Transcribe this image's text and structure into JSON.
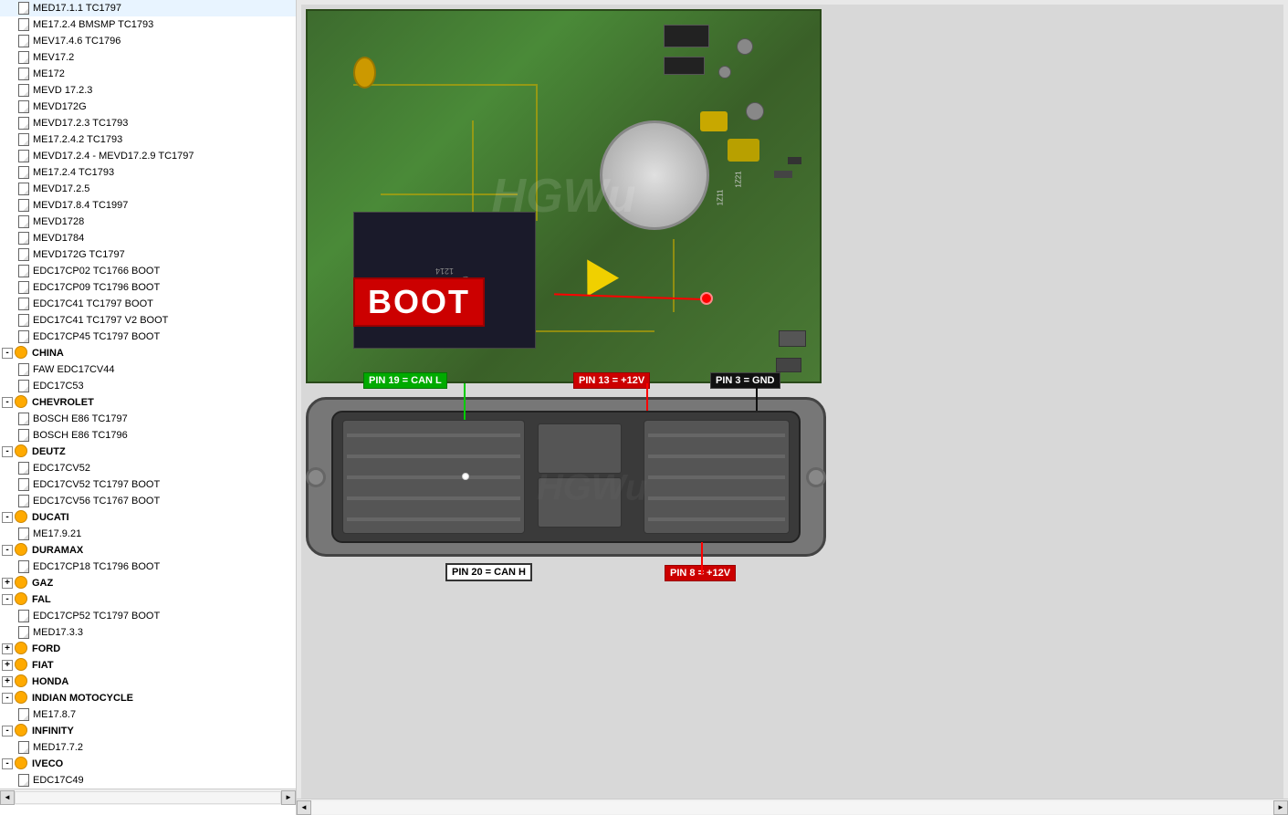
{
  "leftPanel": {
    "treeItems": [
      {
        "id": "med1711",
        "label": "MED17.1.1  TC1797",
        "level": 2,
        "type": "doc"
      },
      {
        "id": "me1724",
        "label": "ME17.2.4  BMSMP TC1793",
        "level": 2,
        "type": "doc"
      },
      {
        "id": "mev1746",
        "label": "MEV17.4.6 TC1796",
        "level": 2,
        "type": "doc"
      },
      {
        "id": "mev172",
        "label": "MEV17.2",
        "level": 2,
        "type": "doc"
      },
      {
        "id": "me172",
        "label": "ME172",
        "level": 2,
        "type": "doc"
      },
      {
        "id": "mevd1723",
        "label": "MEVD 17.2.3",
        "level": 2,
        "type": "doc"
      },
      {
        "id": "mevd172g",
        "label": "MEVD172G",
        "level": 2,
        "type": "doc"
      },
      {
        "id": "mevd1723tc",
        "label": "MEVD17.2.3 TC1793",
        "level": 2,
        "type": "doc"
      },
      {
        "id": "me17242",
        "label": "ME17.2.4.2 TC1793",
        "level": 2,
        "type": "doc"
      },
      {
        "id": "mevd1724",
        "label": "MEVD17.2.4 - MEVD17.2.9 TC1797",
        "level": 2,
        "type": "doc"
      },
      {
        "id": "me17244",
        "label": "ME17.2.4 TC1793",
        "level": 2,
        "type": "doc"
      },
      {
        "id": "mevd1725",
        "label": "MEVD17.2.5",
        "level": 2,
        "type": "doc"
      },
      {
        "id": "mevd1784",
        "label": "MEVD17.8.4 TC1997",
        "level": 2,
        "type": "doc"
      },
      {
        "id": "mevd1728",
        "label": "MEVD1728",
        "level": 2,
        "type": "doc"
      },
      {
        "id": "mevd17284",
        "label": "MEVD1784",
        "level": 2,
        "type": "doc"
      },
      {
        "id": "mevd172gtc",
        "label": "MEVD172G TC1797",
        "level": 2,
        "type": "doc"
      },
      {
        "id": "edc17cp02",
        "label": "EDC17CP02 TC1766 BOOT",
        "level": 2,
        "type": "doc"
      },
      {
        "id": "edc17cp09",
        "label": "EDC17CP09 TC1796 BOOT",
        "level": 2,
        "type": "doc"
      },
      {
        "id": "edc17c41",
        "label": "EDC17C41 TC1797 BOOT",
        "level": 2,
        "type": "doc"
      },
      {
        "id": "edc17c41v2",
        "label": "EDC17C41 TC1797 V2 BOOT",
        "level": 2,
        "type": "doc"
      },
      {
        "id": "edc17cp45",
        "label": "EDC17CP45 TC1797 BOOT",
        "level": 2,
        "type": "doc"
      },
      {
        "id": "china",
        "label": "CHINA",
        "level": 1,
        "type": "folder",
        "expanded": true
      },
      {
        "id": "faw",
        "label": "FAW EDC17CV44",
        "level": 2,
        "type": "doc"
      },
      {
        "id": "edc17c53",
        "label": "EDC17C53",
        "level": 2,
        "type": "doc"
      },
      {
        "id": "chevrolet",
        "label": "CHEVROLET",
        "level": 1,
        "type": "folder",
        "expanded": true
      },
      {
        "id": "bossche86tc1797",
        "label": "BOSCH E86 TC1797",
        "level": 2,
        "type": "doc"
      },
      {
        "id": "bossche86tc1796",
        "label": "BOSCH E86 TC1796",
        "level": 2,
        "type": "doc"
      },
      {
        "id": "deutz",
        "label": "DEUTZ",
        "level": 1,
        "type": "folder",
        "expanded": true
      },
      {
        "id": "edc17cv52",
        "label": "EDC17CV52",
        "level": 2,
        "type": "doc"
      },
      {
        "id": "edc17cv52boot",
        "label": "EDC17CV52 TC1797 BOOT",
        "level": 2,
        "type": "doc"
      },
      {
        "id": "edc17cv56",
        "label": "EDC17CV56 TC1767 BOOT",
        "level": 2,
        "type": "doc"
      },
      {
        "id": "ducati",
        "label": "DUCATI",
        "level": 1,
        "type": "folder",
        "expanded": true
      },
      {
        "id": "me1792",
        "label": "ME17.9.21",
        "level": 2,
        "type": "doc"
      },
      {
        "id": "duramax",
        "label": "DURAMAX",
        "level": 1,
        "type": "folder",
        "expanded": true
      },
      {
        "id": "edc17cp18",
        "label": "EDC17CP18 TC1796 BOOT",
        "level": 2,
        "type": "doc"
      },
      {
        "id": "gaz",
        "label": "GAZ",
        "level": 1,
        "type": "folder",
        "expanded": false
      },
      {
        "id": "fal",
        "label": "FAL",
        "level": 1,
        "type": "folder",
        "expanded": true
      },
      {
        "id": "edc17cp52fal",
        "label": "EDC17CP52 TC1797 BOOT",
        "level": 2,
        "type": "doc"
      },
      {
        "id": "med1733",
        "label": "MED17.3.3",
        "level": 2,
        "type": "doc"
      },
      {
        "id": "ford",
        "label": "FORD",
        "level": 1,
        "type": "folder",
        "expanded": false
      },
      {
        "id": "fiat",
        "label": "FIAT",
        "level": 1,
        "type": "folder",
        "expanded": false
      },
      {
        "id": "honda",
        "label": "HONDA",
        "level": 1,
        "type": "folder",
        "expanded": false
      },
      {
        "id": "indianmoto",
        "label": "INDIAN MOTOCYCLE",
        "level": 1,
        "type": "folder",
        "expanded": true
      },
      {
        "id": "me1787",
        "label": "ME17.8.7",
        "level": 2,
        "type": "doc"
      },
      {
        "id": "infinity",
        "label": "INFINITY",
        "level": 1,
        "type": "folder",
        "expanded": true
      },
      {
        "id": "med1772",
        "label": "MED17.7.2",
        "level": 2,
        "type": "doc"
      },
      {
        "id": "iveco",
        "label": "IVECO",
        "level": 1,
        "type": "folder",
        "expanded": true
      },
      {
        "id": "edc17c49",
        "label": "EDC17C49",
        "level": 2,
        "type": "doc"
      }
    ]
  },
  "rightPanel": {
    "pcbImage": {
      "altText": "PCB circuit board with BOOT label",
      "bootLabel": "BOOT",
      "watermark": "HGWu"
    },
    "connectorImage": {
      "altText": "ECU connector with pin labels",
      "watermark": "HGWu",
      "pinLabels": [
        {
          "id": "pin19",
          "text": "PIN 19 = CAN L",
          "color": "green"
        },
        {
          "id": "pin13",
          "text": "PIN 13 = +12V",
          "color": "red"
        },
        {
          "id": "pin3",
          "text": "PIN 3 = GND",
          "color": "black"
        },
        {
          "id": "pin20",
          "text": "PIN 20 = CAN H",
          "color": "white"
        },
        {
          "id": "pin8",
          "text": "PIN 8 = +12V",
          "color": "red"
        }
      ]
    }
  }
}
